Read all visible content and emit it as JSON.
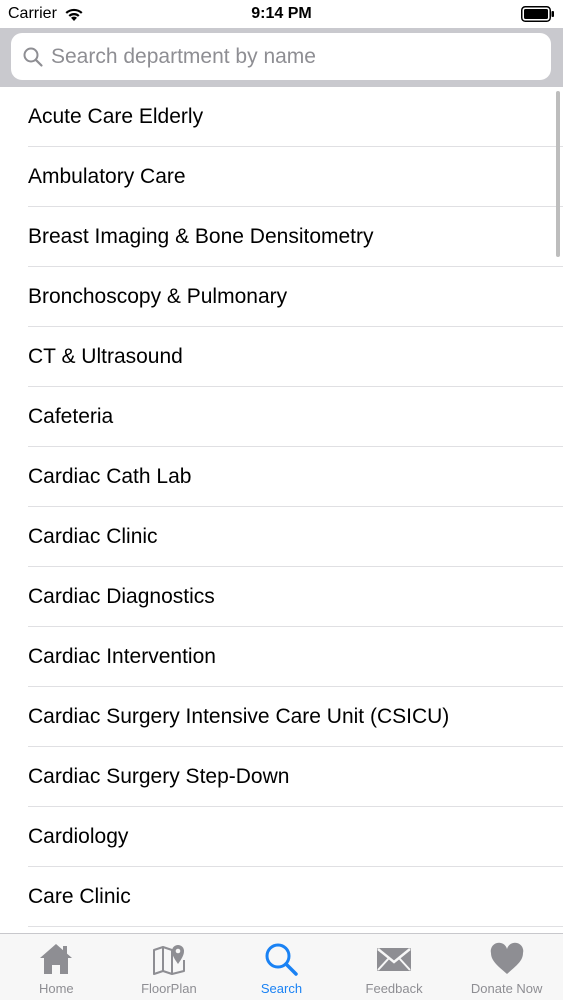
{
  "status_bar": {
    "carrier": "Carrier",
    "time": "9:14 PM",
    "icons": [
      "wifi-icon",
      "battery-icon"
    ]
  },
  "search": {
    "placeholder": "Search department by name",
    "value": "",
    "icon": "search-icon"
  },
  "departments": [
    "Acute Care Elderly",
    "Ambulatory Care",
    "Breast Imaging & Bone Densitometry",
    "Bronchoscopy & Pulmonary",
    "CT & Ultrasound",
    "Cafeteria",
    "Cardiac Cath Lab",
    "Cardiac Clinic",
    "Cardiac Diagnostics",
    "Cardiac Intervention",
    "Cardiac Surgery Intensive Care Unit (CSICU)",
    "Cardiac Surgery Step-Down",
    "Cardiology",
    "Care Clinic"
  ],
  "tab_bar": {
    "active": "search",
    "tabs": [
      {
        "id": "home",
        "label": "Home",
        "icon": "home-icon"
      },
      {
        "id": "floorplan",
        "label": "FloorPlan",
        "icon": "map-pin-icon"
      },
      {
        "id": "search",
        "label": "Search",
        "icon": "search-icon"
      },
      {
        "id": "feedback",
        "label": "Feedback",
        "icon": "envelope-icon"
      },
      {
        "id": "donate",
        "label": "Donate Now",
        "icon": "heart-icon"
      }
    ]
  },
  "colors": {
    "accent": "#1a82f4",
    "inactive_tab": "#8e8e93",
    "search_background": "#c9c9ce",
    "separator": "#e0e0e3",
    "tab_bar_background": "#f7f7f7"
  }
}
